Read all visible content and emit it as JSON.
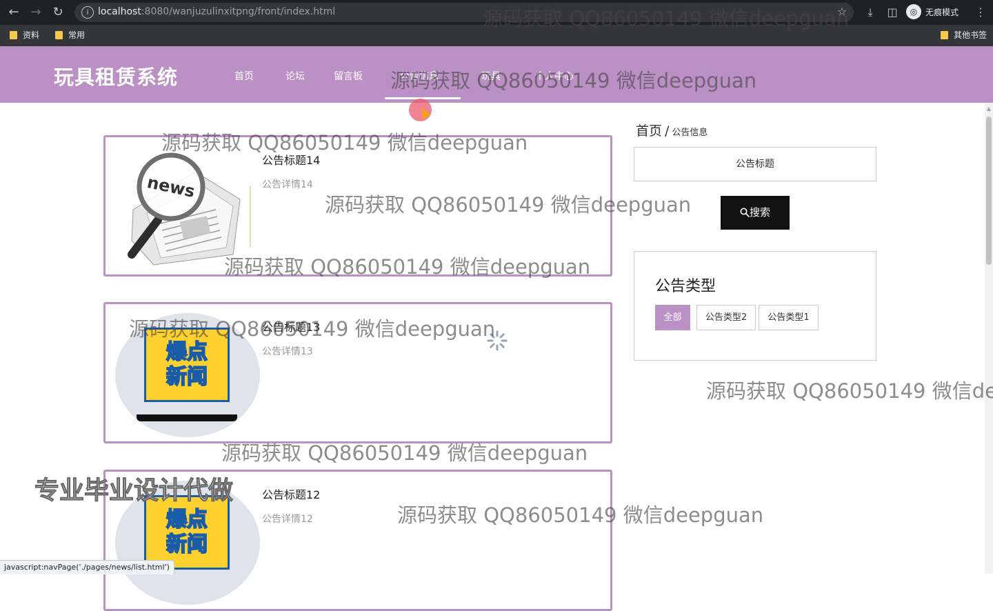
{
  "browser": {
    "url_host": "localhost",
    "url_rest": ":8080/wanjuzulinxitpng/front/index.html",
    "incognito_label": "无痕模式",
    "bookmarks": [
      "资料",
      "常用"
    ],
    "other_bookmarks": "其他书签"
  },
  "site": {
    "title": "玩具租赁系统",
    "nav": [
      "首页",
      "论坛",
      "留言板",
      "公告信息",
      "玩具",
      "个人中心"
    ]
  },
  "cards": [
    {
      "title": "公告标题14",
      "desc": "公告详情14",
      "image": "news-magnifier-image"
    },
    {
      "title": "公告标题13",
      "desc": "公告详情13",
      "image": "breaking-news-image"
    },
    {
      "title": "公告标题12",
      "desc": "公告详情12",
      "image": "breaking-news-image"
    }
  ],
  "thumb_text": "爆点\n新闻",
  "breadcrumb": {
    "home": "首页",
    "sep": "/",
    "current": "公告信息"
  },
  "search": {
    "placeholder": "公告标题",
    "button_label": "搜索",
    "icon": "search-icon"
  },
  "types": {
    "heading": "公告类型",
    "options": [
      "全部",
      "公告类型2",
      "公告类型1"
    ],
    "selected": "全部"
  },
  "watermark": "源码获取 QQ86050149 微信deepguan",
  "promo": "专业毕业设计代做",
  "status_text": "javascript:navPage('./pages/news/list.html')",
  "colors": {
    "theme": "#bb90c5",
    "search_button": "#111111"
  }
}
